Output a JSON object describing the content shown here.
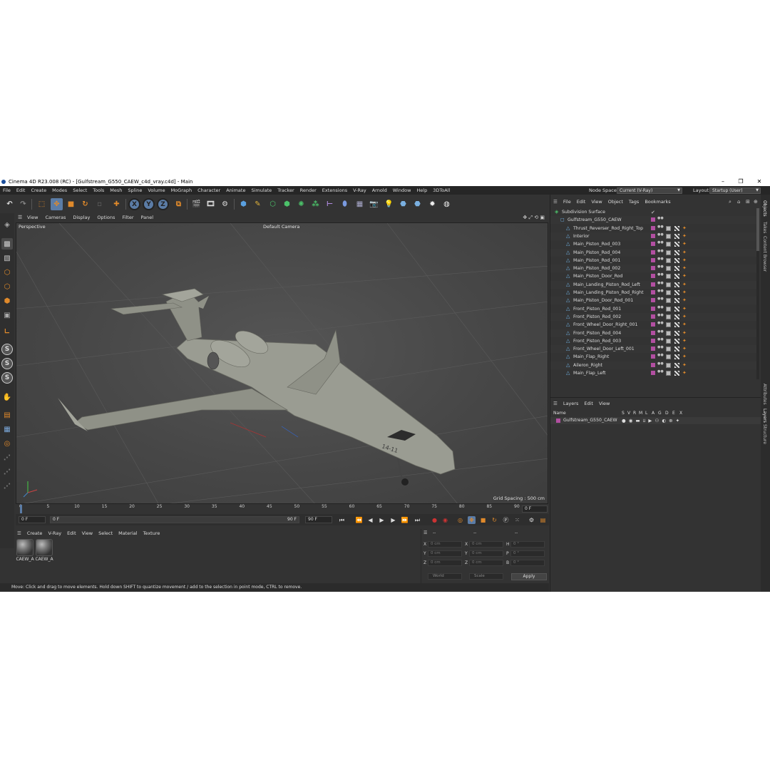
{
  "window": {
    "title": "Cinema 4D R23.008 (RC) - [Gulfstream_G550_CAEW_c4d_vray.c4d] - Main",
    "minimize": "–",
    "maximize": "❐",
    "close": "✕"
  },
  "menubar": {
    "items": [
      "File",
      "Edit",
      "Create",
      "Modes",
      "Select",
      "Tools",
      "Mesh",
      "Spline",
      "Volume",
      "MoGraph",
      "Character",
      "Animate",
      "Simulate",
      "Tracker",
      "Render",
      "Extensions",
      "V-Ray",
      "Arnold",
      "Window",
      "Help",
      "3DToAll"
    ],
    "node_space_label": "Node Space:",
    "node_space_value": "Current (V-Ray)",
    "layout_label": "Layout:",
    "layout_value": "Startup (User)"
  },
  "toolbar": {
    "x_label": "X",
    "y_label": "Y",
    "z_label": "Z"
  },
  "left_tools": {
    "s_label": "S"
  },
  "viewport": {
    "menu": [
      "View",
      "Cameras",
      "Display",
      "Options",
      "Filter",
      "Panel"
    ],
    "view_name": "Perspective",
    "camera_name": "Default Camera",
    "grid_spacing": "Grid Spacing : 500 cm",
    "aircraft_marking": "14-11"
  },
  "timeline": {
    "ticks": [
      "0",
      "5",
      "10",
      "15",
      "20",
      "25",
      "30",
      "35",
      "40",
      "45",
      "50",
      "55",
      "60",
      "65",
      "70",
      "75",
      "80",
      "85",
      "90"
    ],
    "current_frame_right": "0 F",
    "start_field": "0 F",
    "range_start": "0 F",
    "range_end": "90 F",
    "end_field": "90 F"
  },
  "material_manager": {
    "menu": [
      "Create",
      "V-Ray",
      "Edit",
      "View",
      "Select",
      "Material",
      "Texture"
    ],
    "materials": [
      {
        "name": "CAEW_A"
      },
      {
        "name": "CAEW_A"
      }
    ]
  },
  "coordinates": {
    "header_left": "--",
    "header_mid": "--",
    "header_right": "--",
    "rows": [
      {
        "l1": "X",
        "v1": "0 cm",
        "l2": "X",
        "v2": "0 cm",
        "l3": "H",
        "v3": "0 °"
      },
      {
        "l1": "Y",
        "v1": "0 cm",
        "l2": "Y",
        "v2": "0 cm",
        "l3": "P",
        "v3": "0 °"
      },
      {
        "l1": "Z",
        "v1": "0 cm",
        "l2": "Z",
        "v2": "0 cm",
        "l3": "B",
        "v3": "0 °"
      }
    ],
    "mode_dropdown": "World",
    "scale_dropdown": "Scale",
    "apply_label": "Apply"
  },
  "statusbar": {
    "text": "Move: Click and drag to move elements. Hold down SHIFT to quantize movement / add to the selection in point mode, CTRL to remove."
  },
  "object_manager": {
    "menu": [
      "File",
      "Edit",
      "View",
      "Object",
      "Tags",
      "Bookmarks"
    ],
    "objects": [
      {
        "name": "Subdivision Surface",
        "indent": 0,
        "icon": "subdivision-icon"
      },
      {
        "name": "Gulfstream_G550_CAEW",
        "indent": 1,
        "icon": "null-icon"
      },
      {
        "name": "Thrust_Reverser_Rod_Right_Top",
        "indent": 2,
        "icon": "polygon-object-icon"
      },
      {
        "name": "Interior",
        "indent": 2,
        "icon": "polygon-object-icon"
      },
      {
        "name": "Main_Piston_Rod_003",
        "indent": 2,
        "icon": "polygon-object-icon"
      },
      {
        "name": "Main_Piston_Rod_004",
        "indent": 2,
        "icon": "polygon-object-icon"
      },
      {
        "name": "Main_Piston_Rod_001",
        "indent": 2,
        "icon": "polygon-object-icon"
      },
      {
        "name": "Main_Piston_Rod_002",
        "indent": 2,
        "icon": "polygon-object-icon"
      },
      {
        "name": "Main_Piston_Door_Rod",
        "indent": 2,
        "icon": "polygon-object-icon"
      },
      {
        "name": "Main_Landing_Piston_Rod_Left",
        "indent": 2,
        "icon": "polygon-object-icon"
      },
      {
        "name": "Main_Landing_Piston_Rod_Right",
        "indent": 2,
        "icon": "polygon-object-icon"
      },
      {
        "name": "Main_Piston_Door_Rod_001",
        "indent": 2,
        "icon": "polygon-object-icon"
      },
      {
        "name": "Front_Piston_Rod_001",
        "indent": 2,
        "icon": "polygon-object-icon"
      },
      {
        "name": "Front_Piston_Rod_002",
        "indent": 2,
        "icon": "polygon-object-icon"
      },
      {
        "name": "Front_Wheel_Door_Right_001",
        "indent": 2,
        "icon": "polygon-object-icon"
      },
      {
        "name": "Front_Piston_Rod_004",
        "indent": 2,
        "icon": "polygon-object-icon"
      },
      {
        "name": "Front_Piston_Rod_003",
        "indent": 2,
        "icon": "polygon-object-icon"
      },
      {
        "name": "Front_Wheel_Door_Left_001",
        "indent": 2,
        "icon": "polygon-object-icon"
      },
      {
        "name": "Main_Flap_Right",
        "indent": 2,
        "icon": "polygon-object-icon"
      },
      {
        "name": "Aileron_Right",
        "indent": 2,
        "icon": "polygon-object-icon"
      },
      {
        "name": "Main_Flap_Left",
        "indent": 2,
        "icon": "polygon-object-icon"
      }
    ],
    "layer_color": "#b24fa1"
  },
  "layer_manager": {
    "menu": [
      "Layers",
      "Edit",
      "View"
    ],
    "columns": [
      "Name",
      "S",
      "V",
      "R",
      "M",
      "L",
      "A",
      "G",
      "D",
      "E",
      "X"
    ],
    "layers": [
      {
        "name": "Gulfstream_G550_CAEW",
        "color": "#b24fa1"
      }
    ]
  },
  "side_tabs": [
    "Objects",
    "Takes",
    "Content Browser",
    "Attributes",
    "Layers",
    "Structure"
  ],
  "colors": {
    "accent_blue": "#5b7ca6",
    "layer_purple": "#b24fa1",
    "tool_orange": "#e08a2b"
  }
}
